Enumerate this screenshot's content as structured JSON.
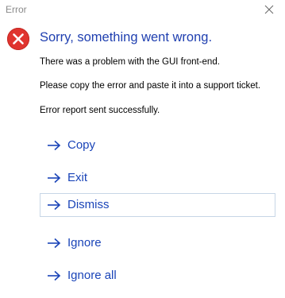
{
  "window": {
    "title": "Error",
    "close_icon": "close-icon"
  },
  "message": {
    "icon": "error-icon",
    "heading": "Sorry, something went wrong.",
    "lines": [
      "There was a problem with the GUI front-end.",
      "Please copy the error and paste it into a support ticket.",
      "Error report sent successfully."
    ]
  },
  "commands": [
    {
      "label": "Copy",
      "icon": "arrow-right-icon"
    },
    {
      "label": "Exit",
      "icon": "arrow-right-icon"
    },
    {
      "label": "Dismiss",
      "icon": "arrow-right-icon",
      "focused": true
    },
    {
      "label": "Ignore",
      "icon": "arrow-right-icon"
    },
    {
      "label": "Ignore all",
      "icon": "arrow-right-icon"
    }
  ],
  "colors": {
    "heading": "#1f3fb0",
    "link": "#1a44b8",
    "error_icon": "#e0342f",
    "focus_border": "#c7d6e6"
  }
}
